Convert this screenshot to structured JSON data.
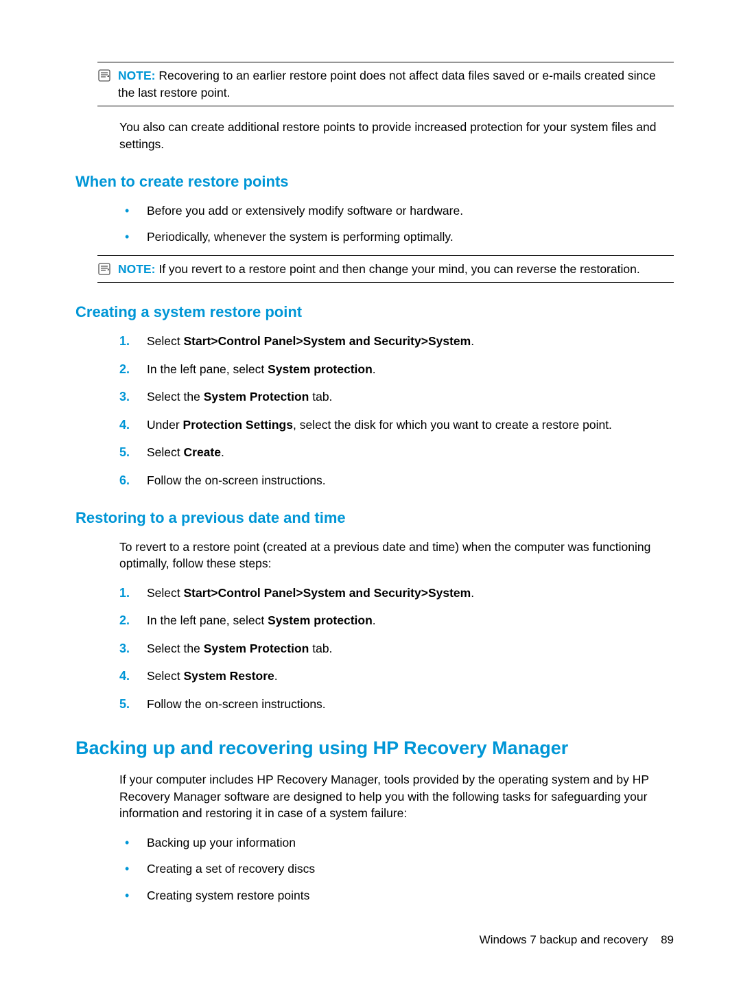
{
  "note1": {
    "label": "NOTE:",
    "text": "Recovering to an earlier restore point does not affect data files saved or e-mails created since the last restore point."
  },
  "para_after_note1": "You also can create additional restore points to provide increased protection for your system files and settings.",
  "sec_when": {
    "title": "When to create restore points",
    "bullets": [
      "Before you add or extensively modify software or hardware.",
      "Periodically, whenever the system is performing optimally."
    ]
  },
  "note2": {
    "label": "NOTE:",
    "text": "If you revert to a restore point and then change your mind, you can reverse the restoration."
  },
  "sec_create": {
    "title": "Creating a system restore point",
    "steps": [
      {
        "pre": "Select ",
        "bold": "Start>Control Panel>System and Security>System",
        "post": "."
      },
      {
        "pre": "In the left pane, select ",
        "bold": "System protection",
        "post": "."
      },
      {
        "pre": "Select the ",
        "bold": "System Protection",
        "post": " tab."
      },
      {
        "pre": "Under ",
        "bold": "Protection Settings",
        "post": ", select the disk for which you want to create a restore point."
      },
      {
        "pre": "Select ",
        "bold": "Create",
        "post": "."
      },
      {
        "pre": "Follow the on-screen instructions.",
        "bold": "",
        "post": ""
      }
    ]
  },
  "sec_restore": {
    "title": "Restoring to a previous date and time",
    "intro": "To revert to a restore point (created at a previous date and time) when the computer was functioning optimally, follow these steps:",
    "steps": [
      {
        "pre": "Select ",
        "bold": "Start>Control Panel>System and Security>System",
        "post": "."
      },
      {
        "pre": "In the left pane, select ",
        "bold": "System protection",
        "post": "."
      },
      {
        "pre": "Select the ",
        "bold": "System Protection",
        "post": " tab."
      },
      {
        "pre": "Select ",
        "bold": "System Restore",
        "post": "."
      },
      {
        "pre": "Follow the on-screen instructions.",
        "bold": "",
        "post": ""
      }
    ]
  },
  "sec_backup": {
    "title": "Backing up and recovering using HP Recovery Manager",
    "intro": "If your computer includes HP Recovery Manager, tools provided by the operating system and by HP Recovery Manager software are designed to help you with the following tasks for safeguarding your information and restoring it in case of a system failure:",
    "bullets": [
      "Backing up your information",
      "Creating a set of recovery discs",
      "Creating system restore points"
    ]
  },
  "footer": {
    "text": "Windows 7 backup and recovery",
    "page": "89"
  }
}
